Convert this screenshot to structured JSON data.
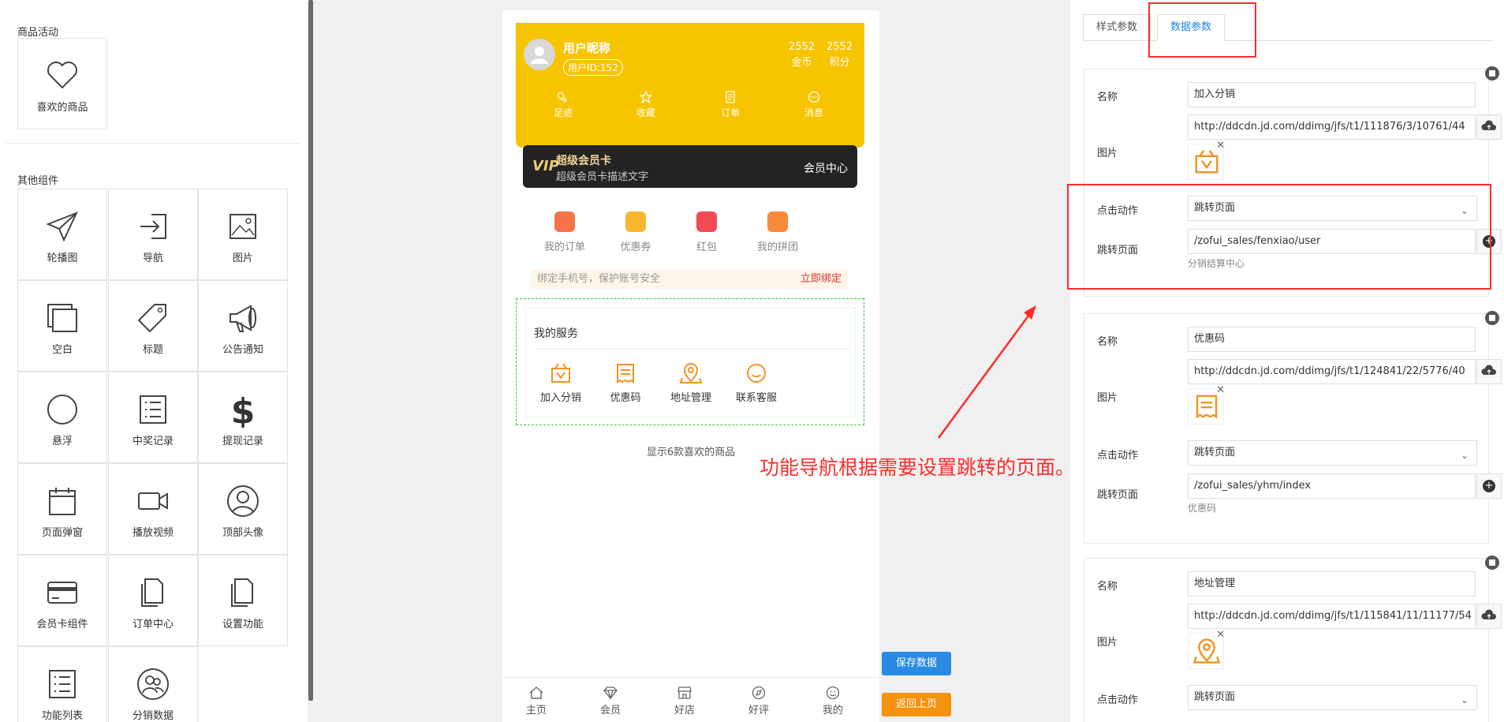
{
  "left_panel": {
    "section_activity": "商品活动",
    "activity_items": [
      {
        "label": "喜欢的商品",
        "icon": "heart-icon"
      }
    ],
    "section_other": "其他组件",
    "components": [
      {
        "label": "轮播图",
        "icon": "paper-plane-icon"
      },
      {
        "label": "导航",
        "icon": "sign-in-icon"
      },
      {
        "label": "图片",
        "icon": "image-icon"
      },
      {
        "label": "空白",
        "icon": "blank-icon"
      },
      {
        "label": "标题",
        "icon": "tag-icon"
      },
      {
        "label": "公告通知",
        "icon": "megaphone-icon"
      },
      {
        "label": "悬浮",
        "icon": "circle-icon"
      },
      {
        "label": "中奖记录",
        "icon": "list-icon"
      },
      {
        "label": "提现记录",
        "icon": "dollar-icon"
      },
      {
        "label": "页面弹窗",
        "icon": "calendar-icon"
      },
      {
        "label": "播放视频",
        "icon": "video-icon"
      },
      {
        "label": "顶部头像",
        "icon": "user-circle-icon"
      },
      {
        "label": "会员卡组件",
        "icon": "credit-card-icon"
      },
      {
        "label": "订单中心",
        "icon": "document-icon"
      },
      {
        "label": "设置功能",
        "icon": "document-icon"
      },
      {
        "label": "功能列表",
        "icon": "list-icon"
      },
      {
        "label": "分销数据",
        "icon": "users-icon"
      }
    ]
  },
  "phone": {
    "user": {
      "nickname": "用户昵称",
      "user_id": "用户ID:152",
      "coins_value": "2552",
      "coins_label": "金币",
      "points_value": "2552",
      "points_label": "积分"
    },
    "user_menu": [
      {
        "label": "足迹",
        "icon": "footprint-icon"
      },
      {
        "label": "收藏",
        "icon": "star-icon"
      },
      {
        "label": "订单",
        "icon": "order-icon"
      },
      {
        "label": "消息",
        "icon": "message-icon"
      }
    ],
    "vip": {
      "badge": "VIP",
      "title": "超级会员卡",
      "desc": "超级会员卡描述文字",
      "center": "会员中心"
    },
    "orders": [
      {
        "label": "我的订单",
        "color": "#f5734a"
      },
      {
        "label": "优惠券",
        "color": "#f7b731"
      },
      {
        "label": "红包",
        "color": "#f04a55"
      },
      {
        "label": "我的拼团",
        "color": "#f78a3a"
      }
    ],
    "bind": {
      "text": "绑定手机号，保护账号安全",
      "button": "立即绑定"
    },
    "services": {
      "title": "我的服务",
      "items": [
        {
          "label": "加入分销",
          "icon": "distribution-icon"
        },
        {
          "label": "优惠码",
          "icon": "coupon-code-icon"
        },
        {
          "label": "地址管理",
          "icon": "location-icon"
        },
        {
          "label": "联系客服",
          "icon": "chat-icon"
        }
      ]
    },
    "likes_text": "显示6款喜欢的商品",
    "tabbar": [
      {
        "label": "主页",
        "icon": "home-icon"
      },
      {
        "label": "会员",
        "icon": "diamond-icon"
      },
      {
        "label": "好店",
        "icon": "shop-icon"
      },
      {
        "label": "好评",
        "icon": "compass-icon"
      },
      {
        "label": "我的",
        "icon": "smile-icon"
      }
    ]
  },
  "buttons": {
    "save": "保存数据",
    "back": "返回上页"
  },
  "annotation": "功能导航根据需要设置跳转的页面。",
  "right_panel": {
    "tabs": {
      "style": "样式参数",
      "data": "数据参数"
    },
    "labels": {
      "name": "名称",
      "image": "图片",
      "action": "点击动作",
      "page": "跳转页面"
    },
    "cards": [
      {
        "name": "加入分销",
        "image_url": "http://ddcdn.jd.com/ddimg/jfs/t1/111876/3/10761/44",
        "action": "跳转页面",
        "page": "/zofui_sales/fenxiao/user",
        "hint": "分销结算中心",
        "icon": "distribution-icon"
      },
      {
        "name": "优惠码",
        "image_url": "http://ddcdn.jd.com/ddimg/jfs/t1/124841/22/5776/40",
        "action": "跳转页面",
        "page": "/zofui_sales/yhm/index",
        "hint": "优惠码",
        "icon": "coupon-code-icon"
      },
      {
        "name": "地址管理",
        "image_url": "http://ddcdn.jd.com/ddimg/jfs/t1/115841/11/11177/54",
        "action": "跳转页面",
        "icon": "location-icon"
      }
    ]
  },
  "colors": {
    "accent": "#1e88e5",
    "brand_yellow": "#f7c400",
    "service_orange": "#f5921e",
    "annotation_red": "#ff2b2b",
    "save_blue": "#2a8ae4",
    "back_orange": "#f5920e"
  }
}
